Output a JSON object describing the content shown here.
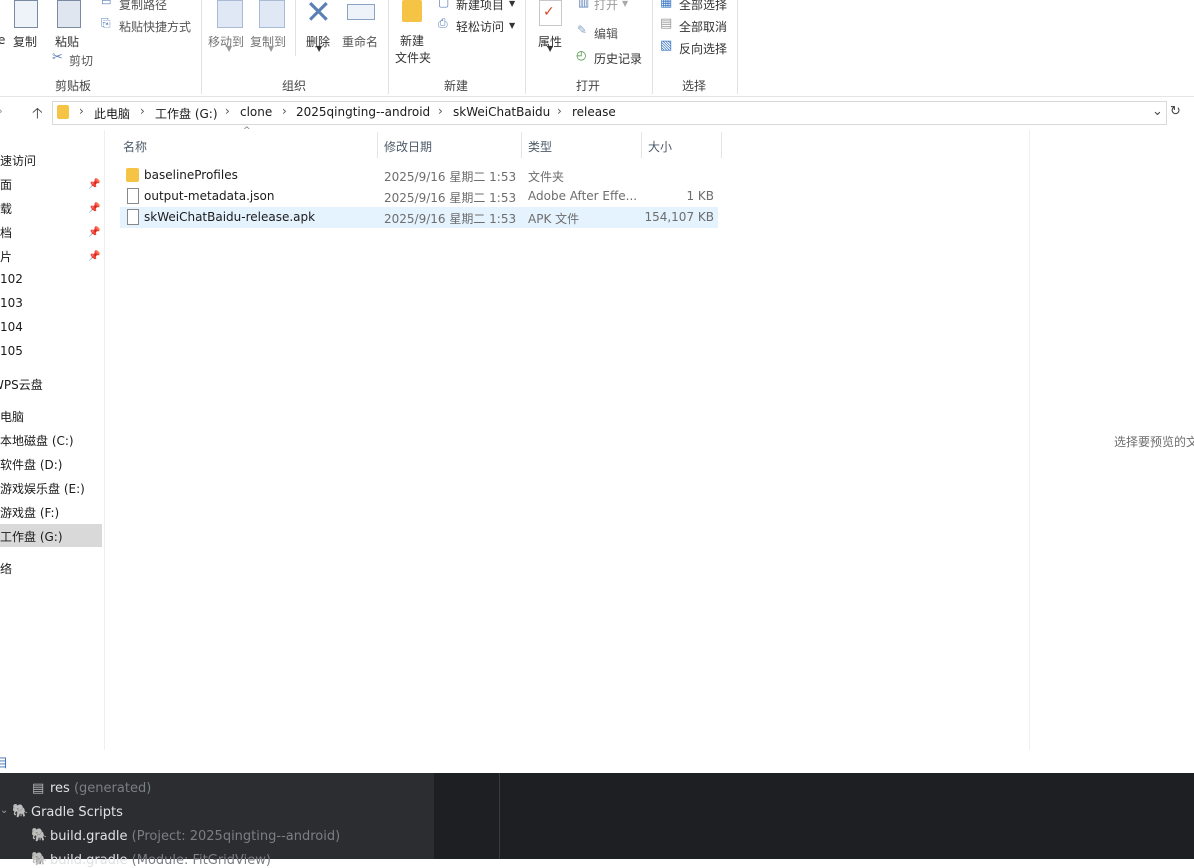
{
  "ribbon": {
    "clipboard": {
      "copy_label": "复制",
      "paste_label": "粘贴",
      "copy_path_label": "复制路径",
      "paste_shortcut_label": "粘贴快捷方式",
      "cut_label": "剪切",
      "group_label": "剪贴板"
    },
    "organize": {
      "move_to_label": "移动到",
      "copy_to_label": "复制到",
      "delete_label": "删除",
      "rename_label": "重命名",
      "group_label": "组织"
    },
    "new": {
      "new_folder_line1": "新建",
      "new_folder_line2": "文件夹",
      "new_item_label": "新建项目",
      "easy_access_label": "轻松访问",
      "group_label": "新建"
    },
    "open": {
      "properties_label": "属性",
      "open_label": "打开",
      "edit_label": "编辑",
      "history_label": "历史记录",
      "group_label": "打开"
    },
    "select": {
      "select_all_label": "全部选择",
      "select_none_label": "全部取消",
      "invert_label": "反向选择",
      "group_label": "选择"
    }
  },
  "address": {
    "crumbs": [
      "此电脑",
      "工作盘 (G:)",
      "clone",
      "2025qingting--android",
      "skWeiChatBaidu",
      "release"
    ]
  },
  "nav": {
    "items": [
      "快速访问",
      "桌面",
      "下载",
      "文档",
      "图片",
      "102",
      "103",
      "104",
      "105",
      "WPS云盘",
      "此电脑",
      "本地磁盘 (C:)",
      "软件盘 (D:)",
      "游戏娱乐盘 (E:)",
      "游戏盘 (F:)",
      "工作盘 (G:)",
      "网络"
    ]
  },
  "columns": {
    "name": "名称",
    "date": "修改日期",
    "type": "类型",
    "size": "大小"
  },
  "files": [
    {
      "name": "baselineProfiles",
      "date": "2025/9/16 星期二 1:53",
      "type": "文件夹",
      "size": ""
    },
    {
      "name": "output-metadata.json",
      "date": "2025/9/16 星期二 1:53",
      "type": "Adobe After Effe...",
      "size": "1 KB"
    },
    {
      "name": "skWeiChatBaidu-release.apk",
      "date": "2025/9/16 星期二 1:53",
      "type": "APK 文件",
      "size": "154,107 KB"
    }
  ],
  "preview": {
    "text": "选择要预览的文"
  },
  "status": {
    "count": "目"
  },
  "ide": {
    "rows": [
      {
        "label": "res",
        "hint": "(generated)"
      },
      {
        "label": "Gradle Scripts",
        "hint": ""
      },
      {
        "label": "build.gradle",
        "hint": "(Project: 2025qingting--android)"
      },
      {
        "label": "build.gradle",
        "hint": "(Module: FitGridView)"
      }
    ]
  },
  "colors": {
    "selection": "#e5f3ff",
    "nav_selected": "#d9d9d9",
    "folder": "#f6c445",
    "ide_bg": "#1e1f22"
  }
}
